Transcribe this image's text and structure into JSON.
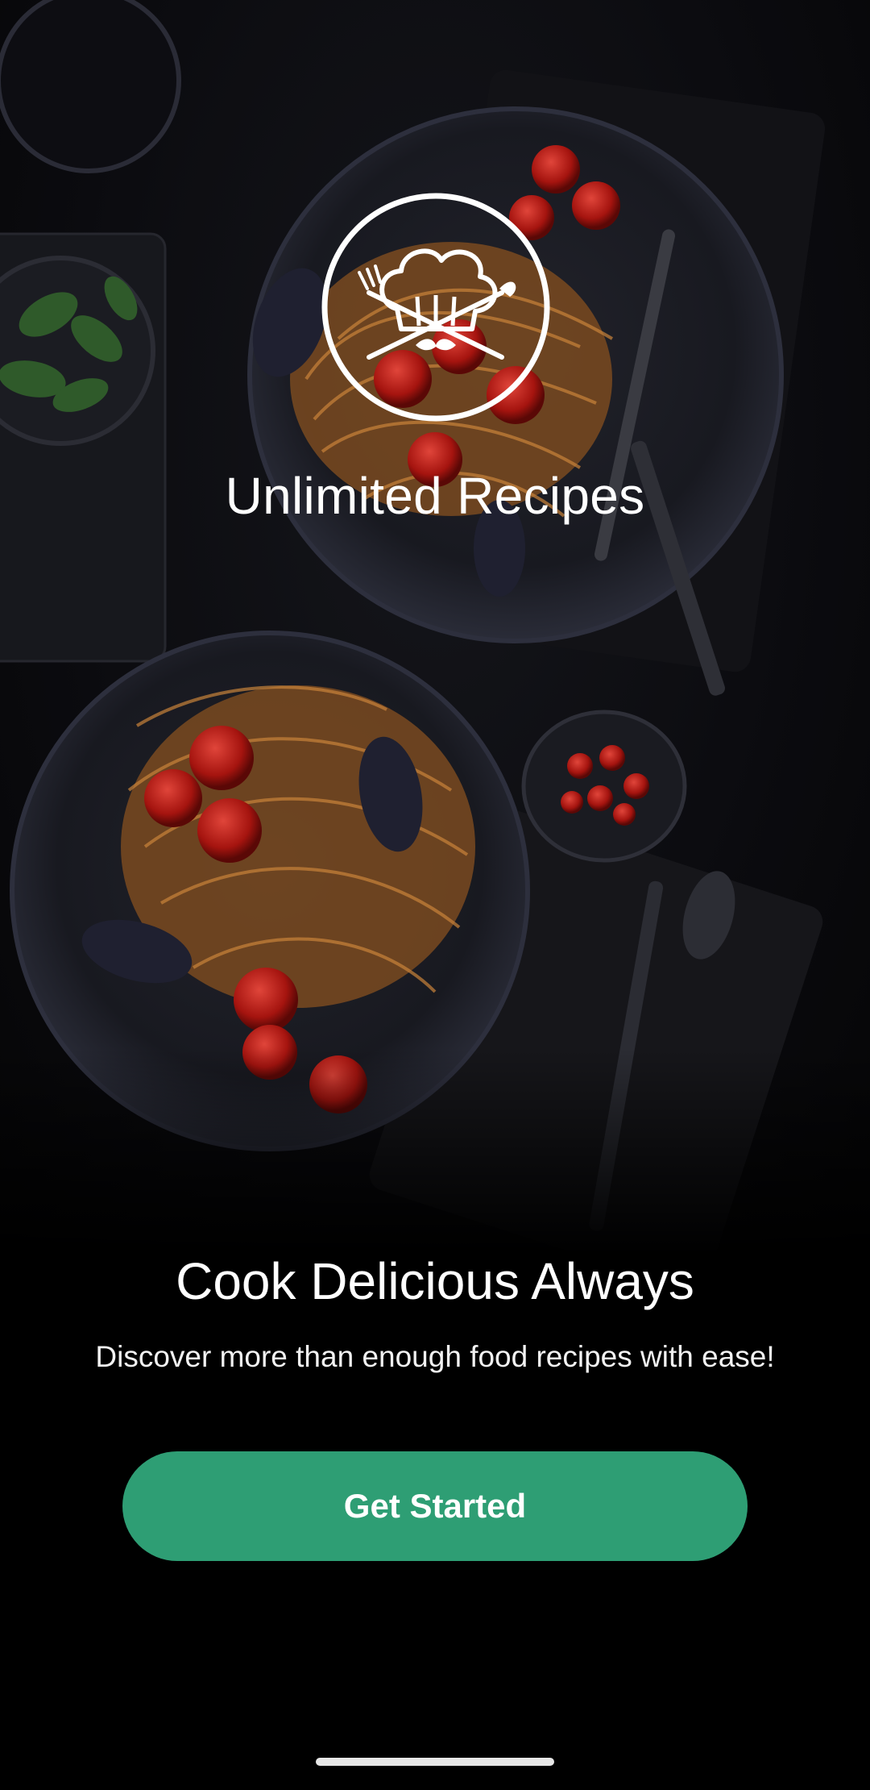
{
  "brand": {
    "logo_icon": "chef-hat-icon",
    "title": "Unlimited Recipes"
  },
  "onboarding": {
    "headline": "Cook Delicious Always",
    "subtext": "Discover more than enough food recipes with ease!",
    "cta_label": "Get Started"
  },
  "colors": {
    "accent": "#2e9e74",
    "background": "#000000",
    "text": "#ffffff"
  },
  "background_image": "dark table with spaghetti, mussels and cherry tomatoes"
}
